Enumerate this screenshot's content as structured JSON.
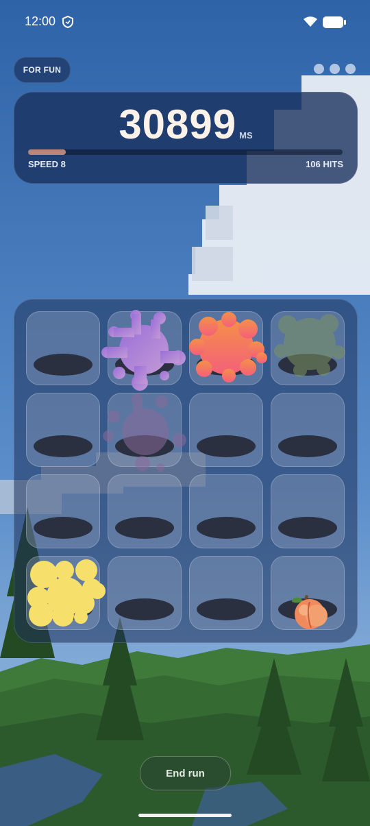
{
  "status_bar": {
    "time": "12:00"
  },
  "mode_chip": {
    "label": "FOR FUN"
  },
  "score": {
    "value": "30899",
    "unit": "MS",
    "progress_fraction": 0.12,
    "speed_label": "SPEED 8",
    "hits_label": "106 HITS"
  },
  "board": {
    "rows": 4,
    "cols": 4,
    "items": [
      {
        "cell": "r1c2",
        "kind": "purple-splat",
        "color": "#a67fd6"
      },
      {
        "cell": "r1c3",
        "kind": "coral-splat",
        "color": "#f4626e"
      },
      {
        "cell": "r1c4",
        "kind": "faded-green-splat",
        "color": "#7c9460"
      },
      {
        "cell": "r2c2",
        "kind": "faded-purple-splat",
        "color": "#8b6a9a"
      },
      {
        "cell": "r4c1",
        "kind": "yellow-splat",
        "color": "#f5dd66"
      },
      {
        "cell": "r4c4",
        "kind": "peach-icon",
        "color": "#f08a5c"
      }
    ]
  },
  "actions": {
    "end_run_label": "End run"
  },
  "colors": {
    "sky_top": "#2f66ad",
    "sky_bottom": "#8fb5dc",
    "forest": "#2e5a2e",
    "panel": "#18305c"
  }
}
